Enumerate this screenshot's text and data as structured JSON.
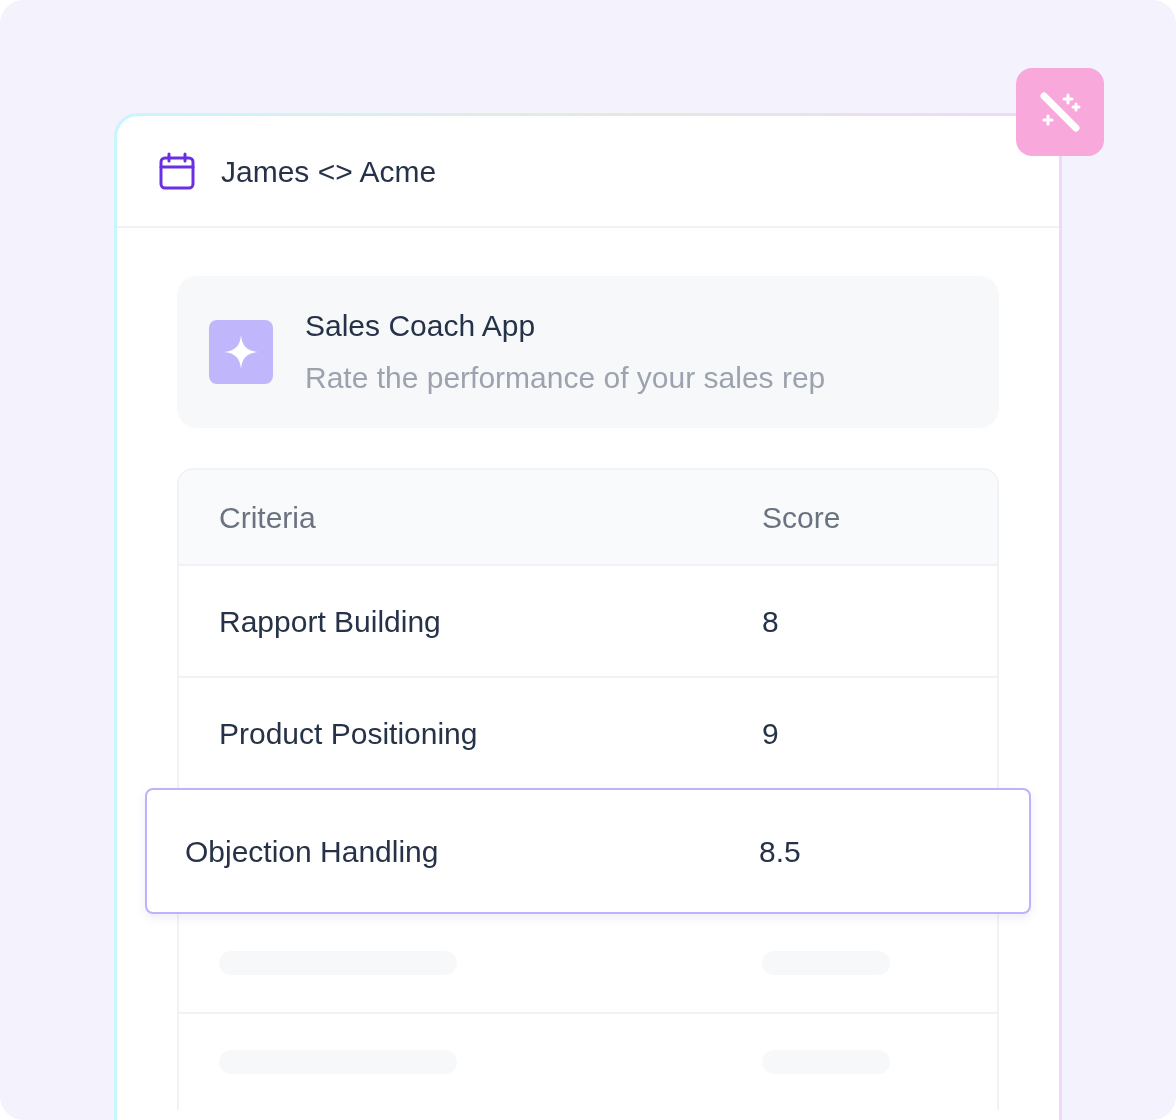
{
  "header": {
    "title": "James <> Acme"
  },
  "app": {
    "title": "Sales Coach App",
    "subtitle": "Rate the performance of your sales rep"
  },
  "table": {
    "columns": [
      "Criteria",
      "Score"
    ],
    "rows": [
      {
        "kind": "score",
        "criteria": "Rapport Building",
        "score": "8",
        "selected": false
      },
      {
        "kind": "score",
        "criteria": "Product Positioning",
        "score": "9",
        "selected": false
      },
      {
        "kind": "score",
        "criteria": "Objection Handling",
        "score": "8.5",
        "selected": true
      },
      {
        "kind": "placeholder"
      },
      {
        "kind": "placeholder"
      }
    ]
  }
}
